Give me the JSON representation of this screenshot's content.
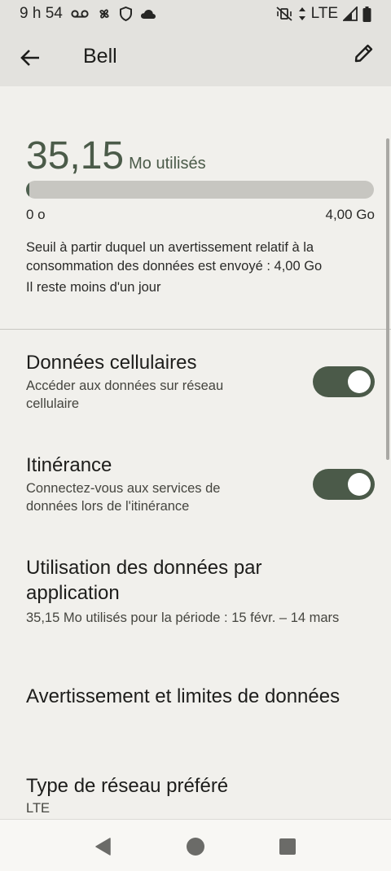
{
  "status_bar": {
    "time": "9 h 54",
    "network": "LTE",
    "icons": [
      "voicemail-icon",
      "fan-icon",
      "shield-icon",
      "cloud-icon",
      "vibrate-off-icon",
      "data-arrows-icon",
      "signal-icon",
      "battery-icon"
    ]
  },
  "app_bar": {
    "title": "Bell",
    "back_icon": "arrow-back-icon",
    "edit_icon": "pencil-icon"
  },
  "usage": {
    "amount": "35,15",
    "unit": "Mo utilisés",
    "progress_fraction": 0.0088,
    "min_label": "0 o",
    "max_label": "4,00 Go",
    "warning_text": "Seuil à partir duquel un avertissement relatif à la consommation des données est envoyé : 4,00 Go",
    "remaining_text": "Il reste moins d'un jour"
  },
  "settings": {
    "mobile_data": {
      "title": "Données cellulaires",
      "subtitle": "Accéder aux données sur réseau cellulaire",
      "enabled": true
    },
    "roaming": {
      "title": "Itinérance",
      "subtitle": "Connectez-vous aux services de données lors de l'itinérance",
      "enabled": true
    },
    "app_usage": {
      "title": "Utilisation des données par application",
      "subtitle": "35,15 Mo utilisés pour la période : 15 févr. – 14 mars"
    },
    "data_warning": {
      "title": "Avertissement et limites de données"
    },
    "network_type": {
      "title": "Type de réseau préféré",
      "subtitle": "LTE"
    }
  },
  "colors": {
    "accent": "#4b5a49",
    "background": "#f1f0ec",
    "app_bar": "#e3e2de",
    "track": "#c7c6c1"
  },
  "nav_bar": {
    "icons": [
      "back-triangle-icon",
      "home-circle-icon",
      "recents-square-icon"
    ]
  }
}
